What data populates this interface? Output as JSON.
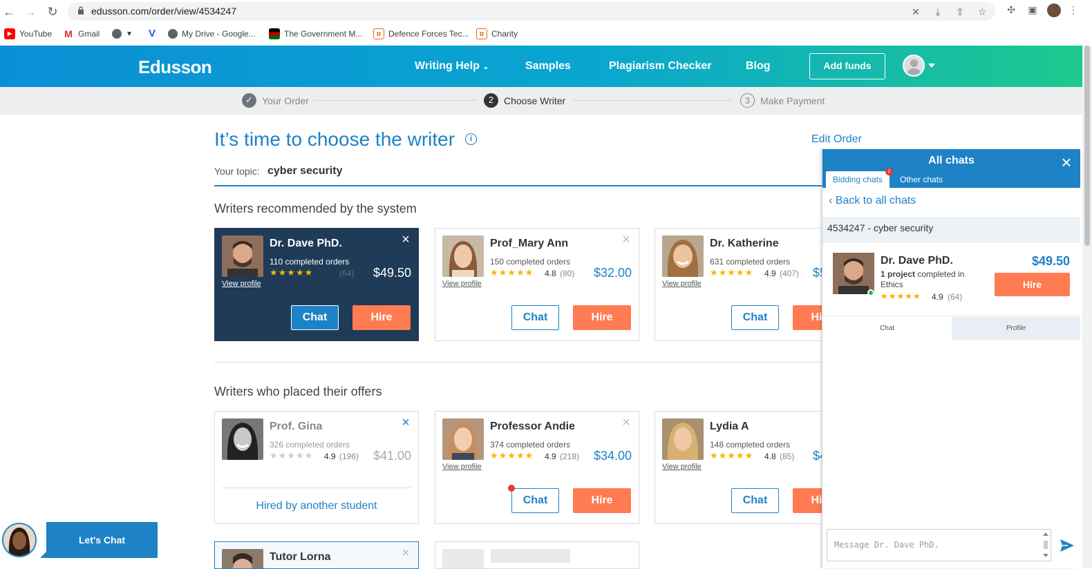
{
  "browser": {
    "url": "edusson.com/order/view/4534247",
    "bookmarks": [
      "YouTube",
      "Gmail",
      "My Drive - Google...",
      "The Government M...",
      "Defence Forces Tec...",
      "Charity"
    ]
  },
  "header": {
    "logo": "Edusson",
    "nav": [
      "Writing Help",
      "Samples",
      "Plagiarism Checker",
      "Blog"
    ],
    "add_funds": "Add funds"
  },
  "steps": [
    {
      "num": "✓",
      "label": "Your Order"
    },
    {
      "num": "2",
      "label": "Choose Writer"
    },
    {
      "num": "3",
      "label": "Make Payment"
    }
  ],
  "main": {
    "title": "It’s time to choose the writer",
    "info": "i",
    "edit_order": "Edit Order",
    "topic_label": "Your topic:",
    "topic_value": "cyber security",
    "recommended_title": "Writers recommended by the system",
    "offers_title": "Writers who placed their offers",
    "view_profile": "View profile",
    "chat_label": "Chat",
    "hire_label": "Hire",
    "hired_by_other": "Hired by another student",
    "stars": "★★★★★"
  },
  "recommended": [
    {
      "name": "Dr. Dave PhD.",
      "orders": "110 completed orders",
      "rating": "4.9",
      "count": "(64)",
      "price": "$49.50"
    },
    {
      "name": "Prof_Mary Ann",
      "orders": "150 completed orders",
      "rating": "4.8",
      "count": "(80)",
      "price": "$32.00"
    },
    {
      "name": "Dr. Katherine",
      "orders": "631 completed orders",
      "rating": "4.9",
      "count": "(407)",
      "price": "$5"
    }
  ],
  "offers": [
    {
      "name": "Prof. Gina",
      "orders": "326 completed orders",
      "rating": "4.9",
      "count": "(196)",
      "price": "$41.00"
    },
    {
      "name": "Professor Andie",
      "orders": "374 completed orders",
      "rating": "4.9",
      "count": "(218)",
      "price": "$34.00"
    },
    {
      "name": "Lydia A",
      "orders": "148 completed orders",
      "rating": "4.8",
      "count": "(85)",
      "price": "$4"
    },
    {
      "name": "Tutor Lorna"
    }
  ],
  "chat_panel": {
    "title": "All chats",
    "tab_bidding": "Bidding chats",
    "tab_other": "Other chats",
    "badge": "2",
    "back": "Back to all chats",
    "order": "4534247 - cyber security",
    "writer_name": "Dr. Dave PhD.",
    "project_bold": "1 project",
    "project_rest": " completed in",
    "project_subject": "Ethics",
    "rating": "4.9",
    "count": "(64)",
    "price": "$49.50",
    "hire": "Hire",
    "tab_chat": "Chat",
    "tab_profile": "Profile",
    "message_placeholder": "Message Dr. Dave PhD."
  },
  "lets_chat": "Let's Chat",
  "colors": {
    "brand_blue": "#1d82c6",
    "hire_orange": "#ff7b52",
    "dark_card": "#1f3b57",
    "star": "#f7b500"
  }
}
